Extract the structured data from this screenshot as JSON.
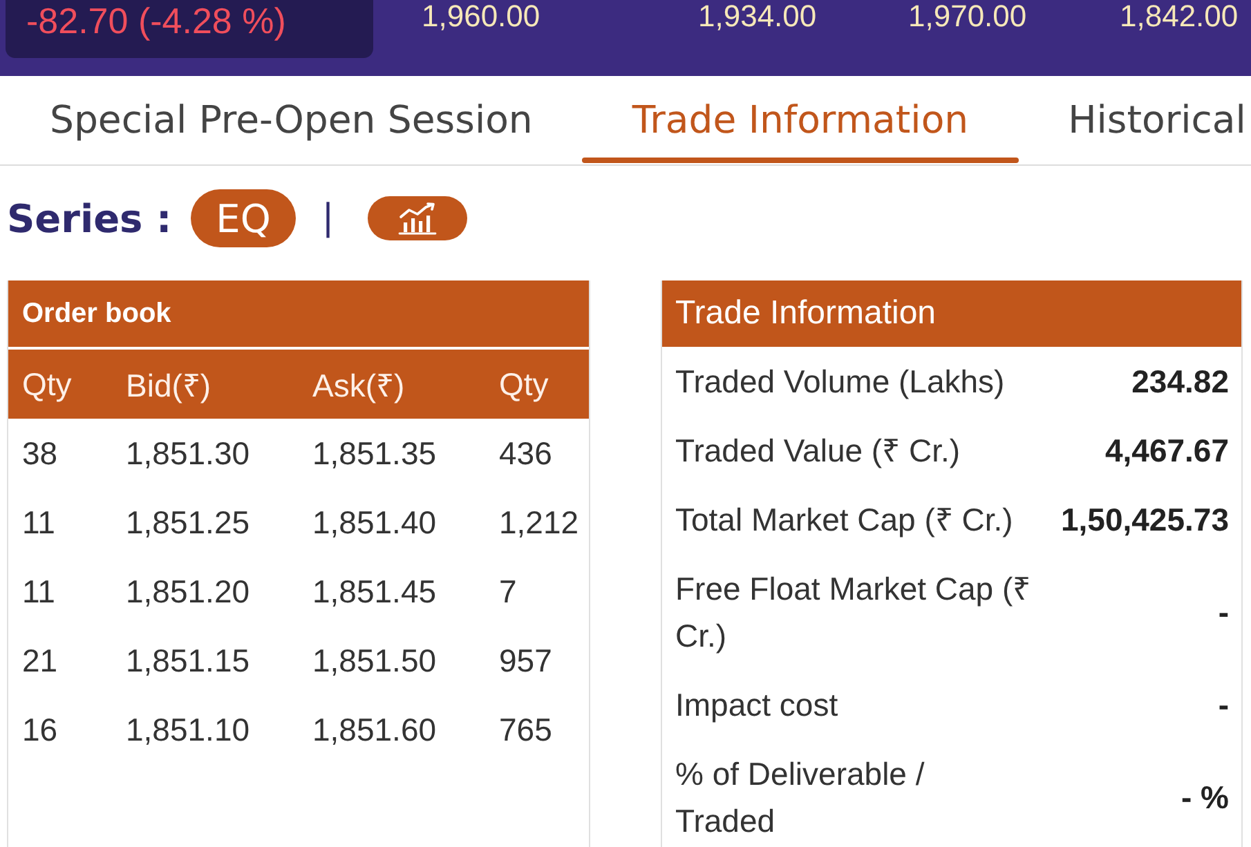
{
  "price_banner": {
    "change": "-82.70 (-4.28 %)",
    "negative": true,
    "values": [
      "1,960.00",
      "1,934.00",
      "1,970.00",
      "1,842.00"
    ]
  },
  "tabs": [
    {
      "label": "Special Pre-Open Session",
      "selected": false
    },
    {
      "label": "Trade Information",
      "selected": true
    },
    {
      "label": "Historical",
      "selected": false
    }
  ],
  "series": {
    "label": "Series :",
    "value": "EQ",
    "separator": "|"
  },
  "order_book": {
    "title": "Order book",
    "columns": [
      "Qty",
      "Bid(₹)",
      "Ask(₹)",
      "Qty"
    ],
    "rows": [
      [
        "38",
        "1,851.30",
        "1,851.35",
        "436"
      ],
      [
        "11",
        "1,851.25",
        "1,851.40",
        "1,212"
      ],
      [
        "11",
        "1,851.20",
        "1,851.45",
        "7"
      ],
      [
        "21",
        "1,851.15",
        "1,851.50",
        "957"
      ],
      [
        "16",
        "1,851.10",
        "1,851.60",
        "765"
      ]
    ]
  },
  "trade_information": {
    "title": "Trade Information",
    "rows": [
      {
        "label": "Traded Volume (Lakhs)",
        "value": "234.82"
      },
      {
        "label": "Traded Value (₹ Cr.)",
        "value": "4,467.67"
      },
      {
        "label": "Total Market Cap (₹ Cr.)",
        "value": "1,50,425.73"
      },
      {
        "label": "Free Float Market Cap (₹ Cr.)",
        "value": "-"
      },
      {
        "label": "Impact cost",
        "value": "-"
      },
      {
        "label": "% of Deliverable / Traded",
        "value": "- %"
      }
    ]
  }
}
